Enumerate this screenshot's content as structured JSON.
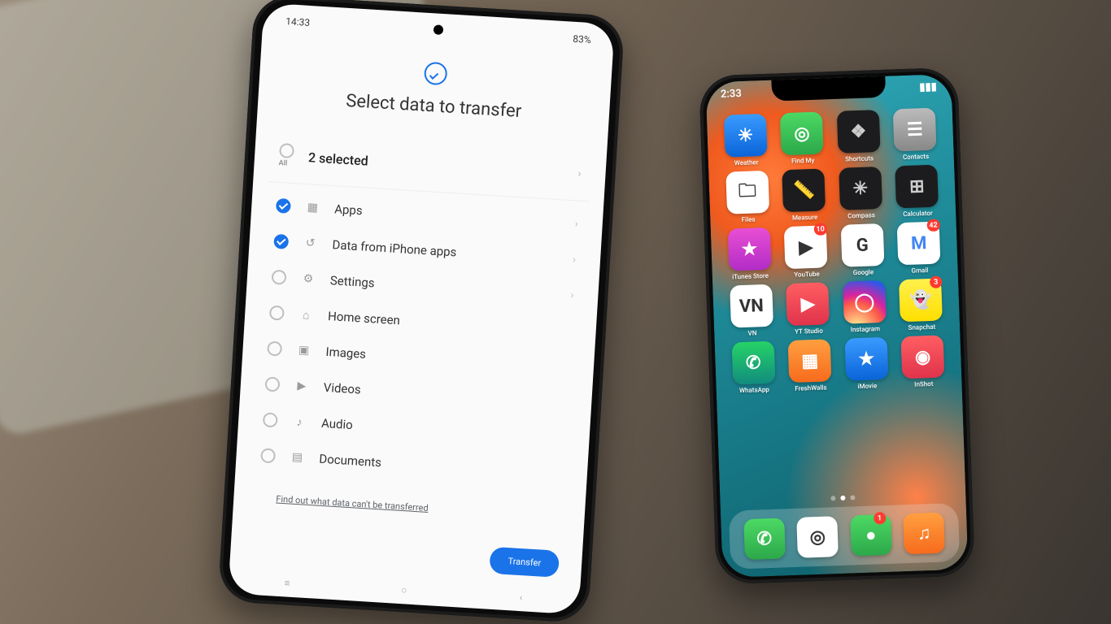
{
  "android": {
    "status": {
      "time": "14:33",
      "battery": "83%",
      "icons": "⋮"
    },
    "title": "Select data to transfer",
    "selected_label": "2 selected",
    "all_label": "All",
    "items": [
      {
        "label": "Apps",
        "glyph": "▦",
        "checked": true,
        "chevron": true
      },
      {
        "label": "Data from iPhone apps",
        "glyph": "↺",
        "checked": true,
        "chevron": true
      },
      {
        "label": "Settings",
        "glyph": "⚙",
        "checked": false,
        "chevron": true
      },
      {
        "label": "Home screen",
        "glyph": "⌂",
        "checked": false,
        "chevron": false
      },
      {
        "label": "Images",
        "glyph": "▣",
        "checked": false,
        "chevron": false
      },
      {
        "label": "Videos",
        "glyph": "▶",
        "checked": false,
        "chevron": false
      },
      {
        "label": "Audio",
        "glyph": "♪",
        "checked": false,
        "chevron": false
      },
      {
        "label": "Documents",
        "glyph": "▤",
        "checked": false,
        "chevron": false
      }
    ],
    "footer_link": "Find out what data can't be transferred",
    "transfer_btn": "Transfer",
    "nav": {
      "recents": "≡",
      "home": "○",
      "back": "‹"
    }
  },
  "ios": {
    "status": {
      "time": "2:33",
      "signal": "▮▮▮",
      "wifi": "⏚",
      "battery": "▮▮▯"
    },
    "rows": [
      [
        {
          "name": "Weather",
          "glyph": "☀",
          "tile": "t-bl",
          "badge": ""
        },
        {
          "name": "Find My",
          "glyph": "◎",
          "tile": "t-gn",
          "badge": ""
        },
        {
          "name": "Shortcuts",
          "glyph": "❖",
          "tile": "t-dk",
          "badge": ""
        },
        {
          "name": "Contacts",
          "glyph": "☰",
          "tile": "t-gr",
          "badge": ""
        }
      ],
      [
        {
          "name": "Files",
          "glyph": "🗀",
          "tile": "t-wh",
          "badge": ""
        },
        {
          "name": "Measure",
          "glyph": "📏",
          "tile": "t-dk",
          "badge": ""
        },
        {
          "name": "Compass",
          "glyph": "✳",
          "tile": "t-dk",
          "badge": ""
        },
        {
          "name": "Calculator",
          "glyph": "⊞",
          "tile": "t-dk",
          "badge": ""
        }
      ],
      [
        {
          "name": "iTunes Store",
          "glyph": "★",
          "tile": "t-mg",
          "badge": ""
        },
        {
          "name": "YouTube",
          "glyph": "▶",
          "tile": "t-wh",
          "badge": "10"
        },
        {
          "name": "Google",
          "glyph": "G",
          "tile": "t-wh",
          "badge": ""
        },
        {
          "name": "Gmail",
          "glyph": "M",
          "tile": "t-ms",
          "badge": "42"
        }
      ],
      [
        {
          "name": "VN",
          "glyph": "VN",
          "tile": "t-wh",
          "badge": ""
        },
        {
          "name": "YT Studio",
          "glyph": "▶",
          "tile": "t-rd",
          "badge": ""
        },
        {
          "name": "Instagram",
          "glyph": "◯",
          "tile": "t-ig",
          "badge": ""
        },
        {
          "name": "Snapchat",
          "glyph": "👻",
          "tile": "t-yl",
          "badge": "3"
        }
      ],
      [
        {
          "name": "WhatsApp",
          "glyph": "✆",
          "tile": "t-gnw",
          "badge": ""
        },
        {
          "name": "FreshWalls",
          "glyph": "▦",
          "tile": "t-or",
          "badge": ""
        },
        {
          "name": "iMovie",
          "glyph": "★",
          "tile": "t-bl",
          "badge": ""
        },
        {
          "name": "InShot",
          "glyph": "◉",
          "tile": "t-rd",
          "badge": ""
        }
      ]
    ],
    "dock": [
      {
        "name": "Phone",
        "glyph": "✆",
        "tile": "t-gn",
        "badge": ""
      },
      {
        "name": "Safari",
        "glyph": "◎",
        "tile": "t-wh",
        "badge": ""
      },
      {
        "name": "Messages",
        "glyph": "●",
        "tile": "t-gn",
        "badge": "1"
      },
      {
        "name": "Music",
        "glyph": "♫",
        "tile": "t-or",
        "badge": ""
      }
    ]
  }
}
